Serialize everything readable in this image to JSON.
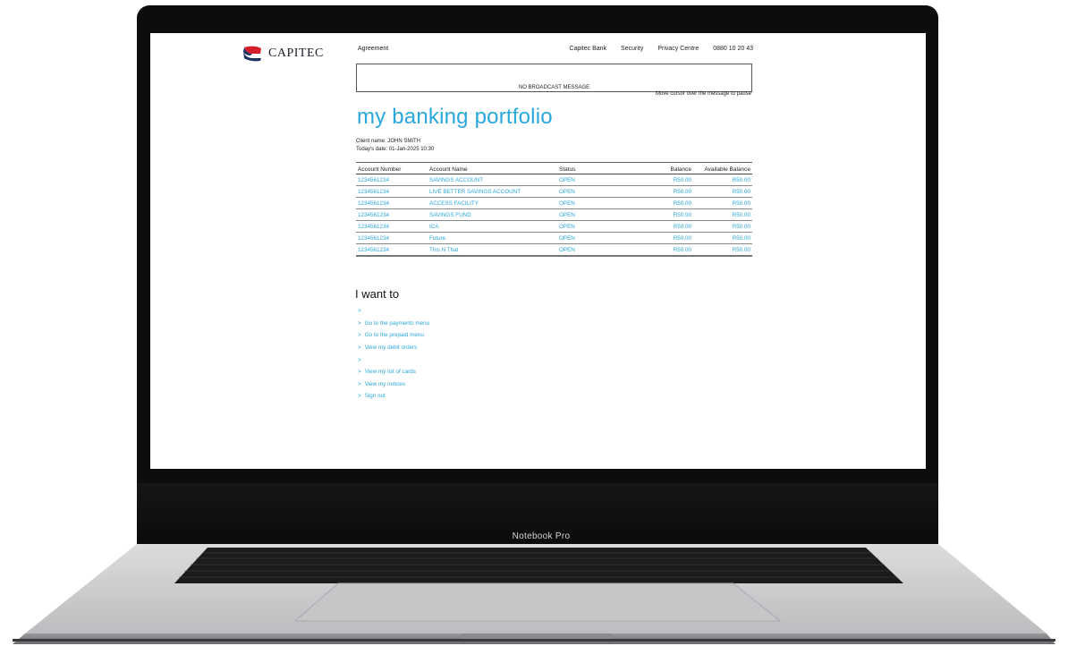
{
  "brand": {
    "logo_text": "CAPITEC",
    "logo_colors": {
      "red": "#d51f2b",
      "navy": "#1e3163"
    }
  },
  "nav": {
    "left": "Agreement",
    "right": [
      "Capitec Bank",
      "Security",
      "Privacy Centre",
      "0880 10 20 43"
    ]
  },
  "broadcast": {
    "message": "NO BROADCAST MESSAGE",
    "hint": "Move cursor over the message to pause"
  },
  "page_title": "my banking portfolio",
  "client": {
    "name_line": "Client name: JOHN SMITH",
    "date_line": "Today's date: 01-Jan-2025 10:30"
  },
  "table": {
    "headers": [
      "Account Number",
      "Account Name",
      "Status",
      "Balance",
      "Available Balance"
    ],
    "rows": [
      [
        "1234561234",
        "SAVINGS ACCOUNT",
        "OPEN",
        "R50.00",
        "R50.00"
      ],
      [
        "1234561234",
        "LIVE BETTER SAVINGS ACCOUNT",
        "OPEN",
        "R50.00",
        "R50.00"
      ],
      [
        "1234561234",
        "ACCESS FACILITY",
        "OPEN",
        "R50.00",
        "R50.00"
      ],
      [
        "1234561234",
        "SAVINGS FUND",
        "OPEN",
        "R50.00",
        "R50.00"
      ],
      [
        "1234561234",
        "ICA",
        "OPEN",
        "R50.00",
        "R50.00"
      ],
      [
        "1234561234",
        "Future",
        "OPEN",
        "R50.00",
        "R50.00"
      ],
      [
        "1234561234",
        "This N That",
        "OPEN",
        "R50.00",
        "R50.00"
      ]
    ]
  },
  "i_want_to": {
    "heading": "I want to",
    "chevron": ">",
    "items": [
      "",
      "Go to the payments menu",
      "Go to the prepaid menu",
      "View my debit orders",
      "",
      "View my list of cards",
      "View my notices",
      "Sign out"
    ]
  },
  "laptop": {
    "label": "Notebook Pro"
  },
  "colors": {
    "accent": "#2aa7dc",
    "text": "#222222"
  }
}
